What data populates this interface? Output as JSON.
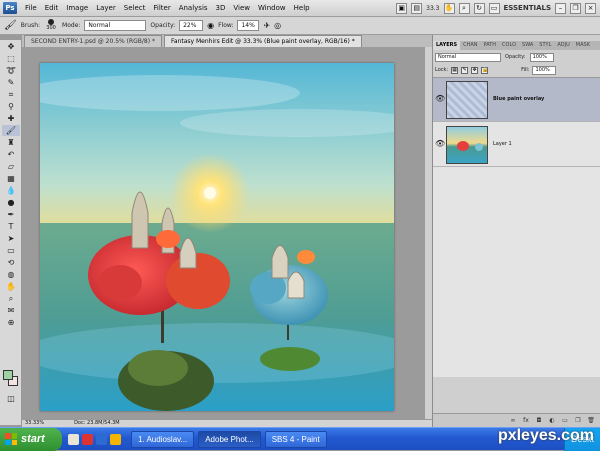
{
  "app": {
    "menu": [
      "File",
      "Edit",
      "Image",
      "Layer",
      "Select",
      "Filter",
      "Analysis",
      "3D",
      "View",
      "Window",
      "Help"
    ],
    "zoom_readout": "33.3",
    "workspace": "ESSENTIALS"
  },
  "options_bar": {
    "brush_label": "Brush:",
    "brush_size": "300",
    "mode_label": "Mode:",
    "mode_value": "Normal",
    "opacity_label": "Opacity:",
    "opacity_value": "22%",
    "flow_label": "Flow:",
    "flow_value": "14%"
  },
  "doc_tabs": [
    {
      "label": "SECOND ENTRY-1.psd @ 20.5% (RGB/8) *",
      "active": false
    },
    {
      "label": "Fantasy Menhirs Edit @ 33.3% (Blue paint overlay, RGB/16) *",
      "active": true
    }
  ],
  "status": {
    "zoom": "33.33%",
    "doc_size": "Doc: 23.8M/54.3M"
  },
  "layers_panel": {
    "tabs": [
      "LAYERS",
      "CHAN",
      "PATH",
      "COLO",
      "SWA",
      "STYL",
      "ADJU",
      "MASK"
    ],
    "blend_mode": "Normal",
    "opacity_label": "Opacity:",
    "opacity_value": "100%",
    "lock_label": "Lock:",
    "fill_label": "Fill:",
    "fill_value": "100%",
    "layers": [
      {
        "name": "Blue paint overlay",
        "selected": true
      },
      {
        "name": "Layer 1",
        "selected": false
      }
    ]
  },
  "taskbar": {
    "start_label": "start",
    "tasks": [
      {
        "label": "1. Audioslav...",
        "active": false
      },
      {
        "label": "Adobe Phot...",
        "active": true
      },
      {
        "label": "SBS 4 - Paint",
        "active": false
      }
    ],
    "tray_label": "Deskt",
    "watermark": "pxleyes.com"
  }
}
